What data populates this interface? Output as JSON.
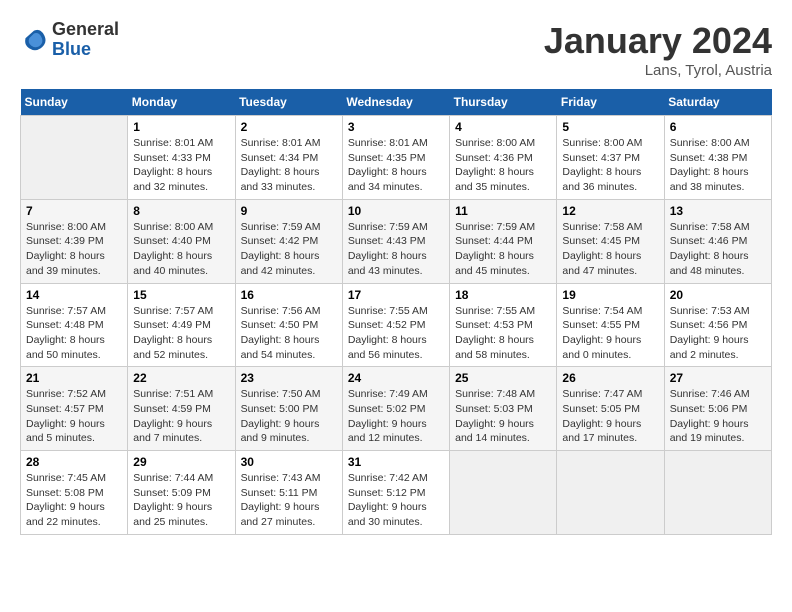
{
  "header": {
    "logo_general": "General",
    "logo_blue": "Blue",
    "month_title": "January 2024",
    "location": "Lans, Tyrol, Austria"
  },
  "days_of_week": [
    "Sunday",
    "Monday",
    "Tuesday",
    "Wednesday",
    "Thursday",
    "Friday",
    "Saturday"
  ],
  "weeks": [
    [
      {
        "day": "",
        "info": ""
      },
      {
        "day": "1",
        "info": "Sunrise: 8:01 AM\nSunset: 4:33 PM\nDaylight: 8 hours\nand 32 minutes."
      },
      {
        "day": "2",
        "info": "Sunrise: 8:01 AM\nSunset: 4:34 PM\nDaylight: 8 hours\nand 33 minutes."
      },
      {
        "day": "3",
        "info": "Sunrise: 8:01 AM\nSunset: 4:35 PM\nDaylight: 8 hours\nand 34 minutes."
      },
      {
        "day": "4",
        "info": "Sunrise: 8:00 AM\nSunset: 4:36 PM\nDaylight: 8 hours\nand 35 minutes."
      },
      {
        "day": "5",
        "info": "Sunrise: 8:00 AM\nSunset: 4:37 PM\nDaylight: 8 hours\nand 36 minutes."
      },
      {
        "day": "6",
        "info": "Sunrise: 8:00 AM\nSunset: 4:38 PM\nDaylight: 8 hours\nand 38 minutes."
      }
    ],
    [
      {
        "day": "7",
        "info": "Sunrise: 8:00 AM\nSunset: 4:39 PM\nDaylight: 8 hours\nand 39 minutes."
      },
      {
        "day": "8",
        "info": "Sunrise: 8:00 AM\nSunset: 4:40 PM\nDaylight: 8 hours\nand 40 minutes."
      },
      {
        "day": "9",
        "info": "Sunrise: 7:59 AM\nSunset: 4:42 PM\nDaylight: 8 hours\nand 42 minutes."
      },
      {
        "day": "10",
        "info": "Sunrise: 7:59 AM\nSunset: 4:43 PM\nDaylight: 8 hours\nand 43 minutes."
      },
      {
        "day": "11",
        "info": "Sunrise: 7:59 AM\nSunset: 4:44 PM\nDaylight: 8 hours\nand 45 minutes."
      },
      {
        "day": "12",
        "info": "Sunrise: 7:58 AM\nSunset: 4:45 PM\nDaylight: 8 hours\nand 47 minutes."
      },
      {
        "day": "13",
        "info": "Sunrise: 7:58 AM\nSunset: 4:46 PM\nDaylight: 8 hours\nand 48 minutes."
      }
    ],
    [
      {
        "day": "14",
        "info": "Sunrise: 7:57 AM\nSunset: 4:48 PM\nDaylight: 8 hours\nand 50 minutes."
      },
      {
        "day": "15",
        "info": "Sunrise: 7:57 AM\nSunset: 4:49 PM\nDaylight: 8 hours\nand 52 minutes."
      },
      {
        "day": "16",
        "info": "Sunrise: 7:56 AM\nSunset: 4:50 PM\nDaylight: 8 hours\nand 54 minutes."
      },
      {
        "day": "17",
        "info": "Sunrise: 7:55 AM\nSunset: 4:52 PM\nDaylight: 8 hours\nand 56 minutes."
      },
      {
        "day": "18",
        "info": "Sunrise: 7:55 AM\nSunset: 4:53 PM\nDaylight: 8 hours\nand 58 minutes."
      },
      {
        "day": "19",
        "info": "Sunrise: 7:54 AM\nSunset: 4:55 PM\nDaylight: 9 hours\nand 0 minutes."
      },
      {
        "day": "20",
        "info": "Sunrise: 7:53 AM\nSunset: 4:56 PM\nDaylight: 9 hours\nand 2 minutes."
      }
    ],
    [
      {
        "day": "21",
        "info": "Sunrise: 7:52 AM\nSunset: 4:57 PM\nDaylight: 9 hours\nand 5 minutes."
      },
      {
        "day": "22",
        "info": "Sunrise: 7:51 AM\nSunset: 4:59 PM\nDaylight: 9 hours\nand 7 minutes."
      },
      {
        "day": "23",
        "info": "Sunrise: 7:50 AM\nSunset: 5:00 PM\nDaylight: 9 hours\nand 9 minutes."
      },
      {
        "day": "24",
        "info": "Sunrise: 7:49 AM\nSunset: 5:02 PM\nDaylight: 9 hours\nand 12 minutes."
      },
      {
        "day": "25",
        "info": "Sunrise: 7:48 AM\nSunset: 5:03 PM\nDaylight: 9 hours\nand 14 minutes."
      },
      {
        "day": "26",
        "info": "Sunrise: 7:47 AM\nSunset: 5:05 PM\nDaylight: 9 hours\nand 17 minutes."
      },
      {
        "day": "27",
        "info": "Sunrise: 7:46 AM\nSunset: 5:06 PM\nDaylight: 9 hours\nand 19 minutes."
      }
    ],
    [
      {
        "day": "28",
        "info": "Sunrise: 7:45 AM\nSunset: 5:08 PM\nDaylight: 9 hours\nand 22 minutes."
      },
      {
        "day": "29",
        "info": "Sunrise: 7:44 AM\nSunset: 5:09 PM\nDaylight: 9 hours\nand 25 minutes."
      },
      {
        "day": "30",
        "info": "Sunrise: 7:43 AM\nSunset: 5:11 PM\nDaylight: 9 hours\nand 27 minutes."
      },
      {
        "day": "31",
        "info": "Sunrise: 7:42 AM\nSunset: 5:12 PM\nDaylight: 9 hours\nand 30 minutes."
      },
      {
        "day": "",
        "info": ""
      },
      {
        "day": "",
        "info": ""
      },
      {
        "day": "",
        "info": ""
      }
    ]
  ]
}
